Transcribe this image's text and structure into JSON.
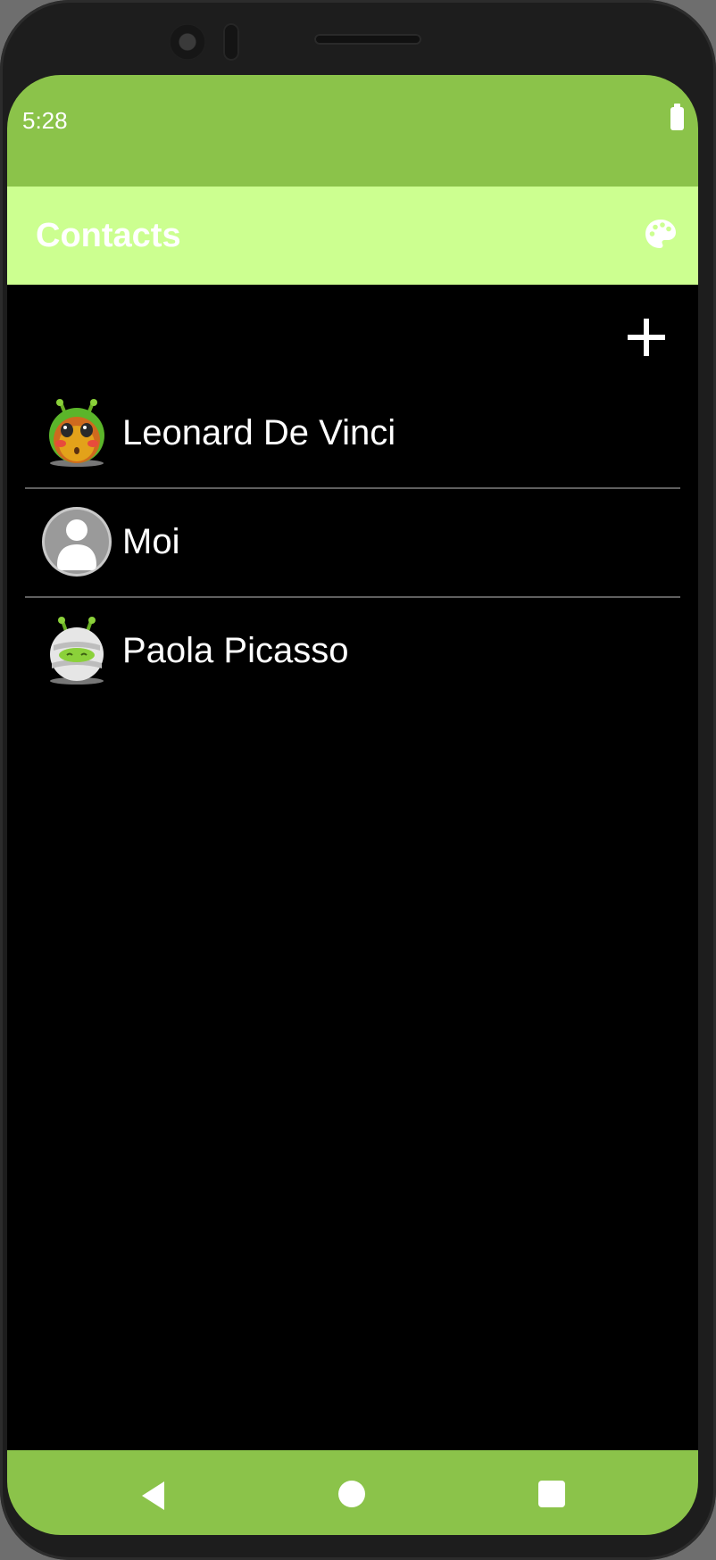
{
  "status_bar": {
    "time": "5:28",
    "battery_icon": "battery-full-icon"
  },
  "app_bar": {
    "title": "Contacts",
    "theme_icon": "palette-icon"
  },
  "actions": {
    "add_icon": "plus-icon"
  },
  "contacts": [
    {
      "name": "Leonard De Vinci",
      "avatar_icon": "alien-blushing-avatar-icon"
    },
    {
      "name": "Moi",
      "avatar_icon": "default-person-avatar-icon"
    },
    {
      "name": "Paola Picasso",
      "avatar_icon": "alien-mummy-avatar-icon"
    }
  ],
  "nav_bar": {
    "back_icon": "back-triangle-icon",
    "home_icon": "home-circle-icon",
    "recents_icon": "recents-square-icon"
  },
  "colors": {
    "status_bar": "#8bc34a",
    "app_bar": "#ccff90",
    "background": "#000000",
    "divider": "#5f5f5f"
  }
}
